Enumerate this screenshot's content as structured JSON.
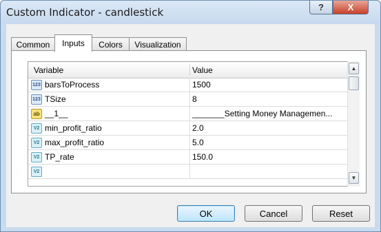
{
  "window": {
    "title": "Custom Indicator - candlestick",
    "help_label": "?",
    "close_label": "X"
  },
  "tabs": [
    {
      "label": "Common"
    },
    {
      "label": "Inputs"
    },
    {
      "label": "Colors"
    },
    {
      "label": "Visualization"
    }
  ],
  "grid": {
    "columns": [
      "Variable",
      "Value"
    ],
    "rows": [
      {
        "icon": "123",
        "name": "barsToProcess",
        "value": "1500"
      },
      {
        "icon": "123",
        "name": "TSize",
        "value": "8"
      },
      {
        "icon": "ab",
        "name": "__1__",
        "value": "_______Setting Money Managemen..."
      },
      {
        "icon": "V2",
        "name": "min_profit_ratio",
        "value": "2.0"
      },
      {
        "icon": "V2",
        "name": "max_profit_ratio",
        "value": "5.0"
      },
      {
        "icon": "V2",
        "name": "TP_rate",
        "value": "150.0"
      },
      {
        "icon": "V2",
        "name": "",
        "value": ""
      }
    ]
  },
  "buttons": {
    "ok": "OK",
    "cancel": "Cancel",
    "reset": "Reset"
  }
}
